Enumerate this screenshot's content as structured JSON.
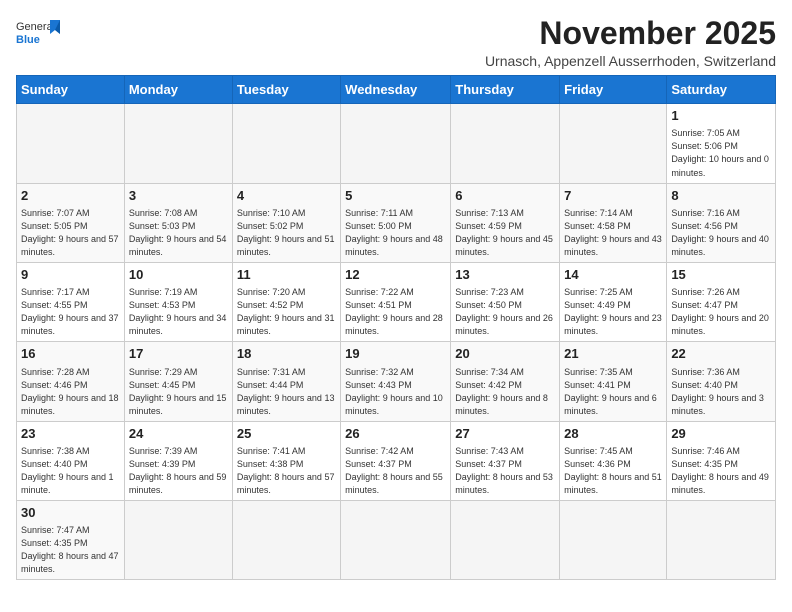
{
  "header": {
    "logo_general": "General",
    "logo_blue": "Blue",
    "title": "November 2025",
    "subtitle": "Urnasch, Appenzell Ausserrhoden, Switzerland"
  },
  "days_of_week": [
    "Sunday",
    "Monday",
    "Tuesday",
    "Wednesday",
    "Thursday",
    "Friday",
    "Saturday"
  ],
  "weeks": [
    [
      {
        "day": "",
        "empty": true
      },
      {
        "day": "",
        "empty": true
      },
      {
        "day": "",
        "empty": true
      },
      {
        "day": "",
        "empty": true
      },
      {
        "day": "",
        "empty": true
      },
      {
        "day": "",
        "empty": true
      },
      {
        "day": "1",
        "sunrise": "7:05 AM",
        "sunset": "5:06 PM",
        "daylight": "10 hours and 0 minutes."
      }
    ],
    [
      {
        "day": "2",
        "sunrise": "7:07 AM",
        "sunset": "5:05 PM",
        "daylight": "9 hours and 57 minutes."
      },
      {
        "day": "3",
        "sunrise": "7:08 AM",
        "sunset": "5:03 PM",
        "daylight": "9 hours and 54 minutes."
      },
      {
        "day": "4",
        "sunrise": "7:10 AM",
        "sunset": "5:02 PM",
        "daylight": "9 hours and 51 minutes."
      },
      {
        "day": "5",
        "sunrise": "7:11 AM",
        "sunset": "5:00 PM",
        "daylight": "9 hours and 48 minutes."
      },
      {
        "day": "6",
        "sunrise": "7:13 AM",
        "sunset": "4:59 PM",
        "daylight": "9 hours and 45 minutes."
      },
      {
        "day": "7",
        "sunrise": "7:14 AM",
        "sunset": "4:58 PM",
        "daylight": "9 hours and 43 minutes."
      },
      {
        "day": "8",
        "sunrise": "7:16 AM",
        "sunset": "4:56 PM",
        "daylight": "9 hours and 40 minutes."
      }
    ],
    [
      {
        "day": "9",
        "sunrise": "7:17 AM",
        "sunset": "4:55 PM",
        "daylight": "9 hours and 37 minutes."
      },
      {
        "day": "10",
        "sunrise": "7:19 AM",
        "sunset": "4:53 PM",
        "daylight": "9 hours and 34 minutes."
      },
      {
        "day": "11",
        "sunrise": "7:20 AM",
        "sunset": "4:52 PM",
        "daylight": "9 hours and 31 minutes."
      },
      {
        "day": "12",
        "sunrise": "7:22 AM",
        "sunset": "4:51 PM",
        "daylight": "9 hours and 28 minutes."
      },
      {
        "day": "13",
        "sunrise": "7:23 AM",
        "sunset": "4:50 PM",
        "daylight": "9 hours and 26 minutes."
      },
      {
        "day": "14",
        "sunrise": "7:25 AM",
        "sunset": "4:49 PM",
        "daylight": "9 hours and 23 minutes."
      },
      {
        "day": "15",
        "sunrise": "7:26 AM",
        "sunset": "4:47 PM",
        "daylight": "9 hours and 20 minutes."
      }
    ],
    [
      {
        "day": "16",
        "sunrise": "7:28 AM",
        "sunset": "4:46 PM",
        "daylight": "9 hours and 18 minutes."
      },
      {
        "day": "17",
        "sunrise": "7:29 AM",
        "sunset": "4:45 PM",
        "daylight": "9 hours and 15 minutes."
      },
      {
        "day": "18",
        "sunrise": "7:31 AM",
        "sunset": "4:44 PM",
        "daylight": "9 hours and 13 minutes."
      },
      {
        "day": "19",
        "sunrise": "7:32 AM",
        "sunset": "4:43 PM",
        "daylight": "9 hours and 10 minutes."
      },
      {
        "day": "20",
        "sunrise": "7:34 AM",
        "sunset": "4:42 PM",
        "daylight": "9 hours and 8 minutes."
      },
      {
        "day": "21",
        "sunrise": "7:35 AM",
        "sunset": "4:41 PM",
        "daylight": "9 hours and 6 minutes."
      },
      {
        "day": "22",
        "sunrise": "7:36 AM",
        "sunset": "4:40 PM",
        "daylight": "9 hours and 3 minutes."
      }
    ],
    [
      {
        "day": "23",
        "sunrise": "7:38 AM",
        "sunset": "4:40 PM",
        "daylight": "9 hours and 1 minute."
      },
      {
        "day": "24",
        "sunrise": "7:39 AM",
        "sunset": "4:39 PM",
        "daylight": "8 hours and 59 minutes."
      },
      {
        "day": "25",
        "sunrise": "7:41 AM",
        "sunset": "4:38 PM",
        "daylight": "8 hours and 57 minutes."
      },
      {
        "day": "26",
        "sunrise": "7:42 AM",
        "sunset": "4:37 PM",
        "daylight": "8 hours and 55 minutes."
      },
      {
        "day": "27",
        "sunrise": "7:43 AM",
        "sunset": "4:37 PM",
        "daylight": "8 hours and 53 minutes."
      },
      {
        "day": "28",
        "sunrise": "7:45 AM",
        "sunset": "4:36 PM",
        "daylight": "8 hours and 51 minutes."
      },
      {
        "day": "29",
        "sunrise": "7:46 AM",
        "sunset": "4:35 PM",
        "daylight": "8 hours and 49 minutes."
      }
    ],
    [
      {
        "day": "30",
        "sunrise": "7:47 AM",
        "sunset": "4:35 PM",
        "daylight": "8 hours and 47 minutes."
      },
      {
        "day": "",
        "empty": true
      },
      {
        "day": "",
        "empty": true
      },
      {
        "day": "",
        "empty": true
      },
      {
        "day": "",
        "empty": true
      },
      {
        "day": "",
        "empty": true
      },
      {
        "day": "",
        "empty": true
      }
    ]
  ]
}
